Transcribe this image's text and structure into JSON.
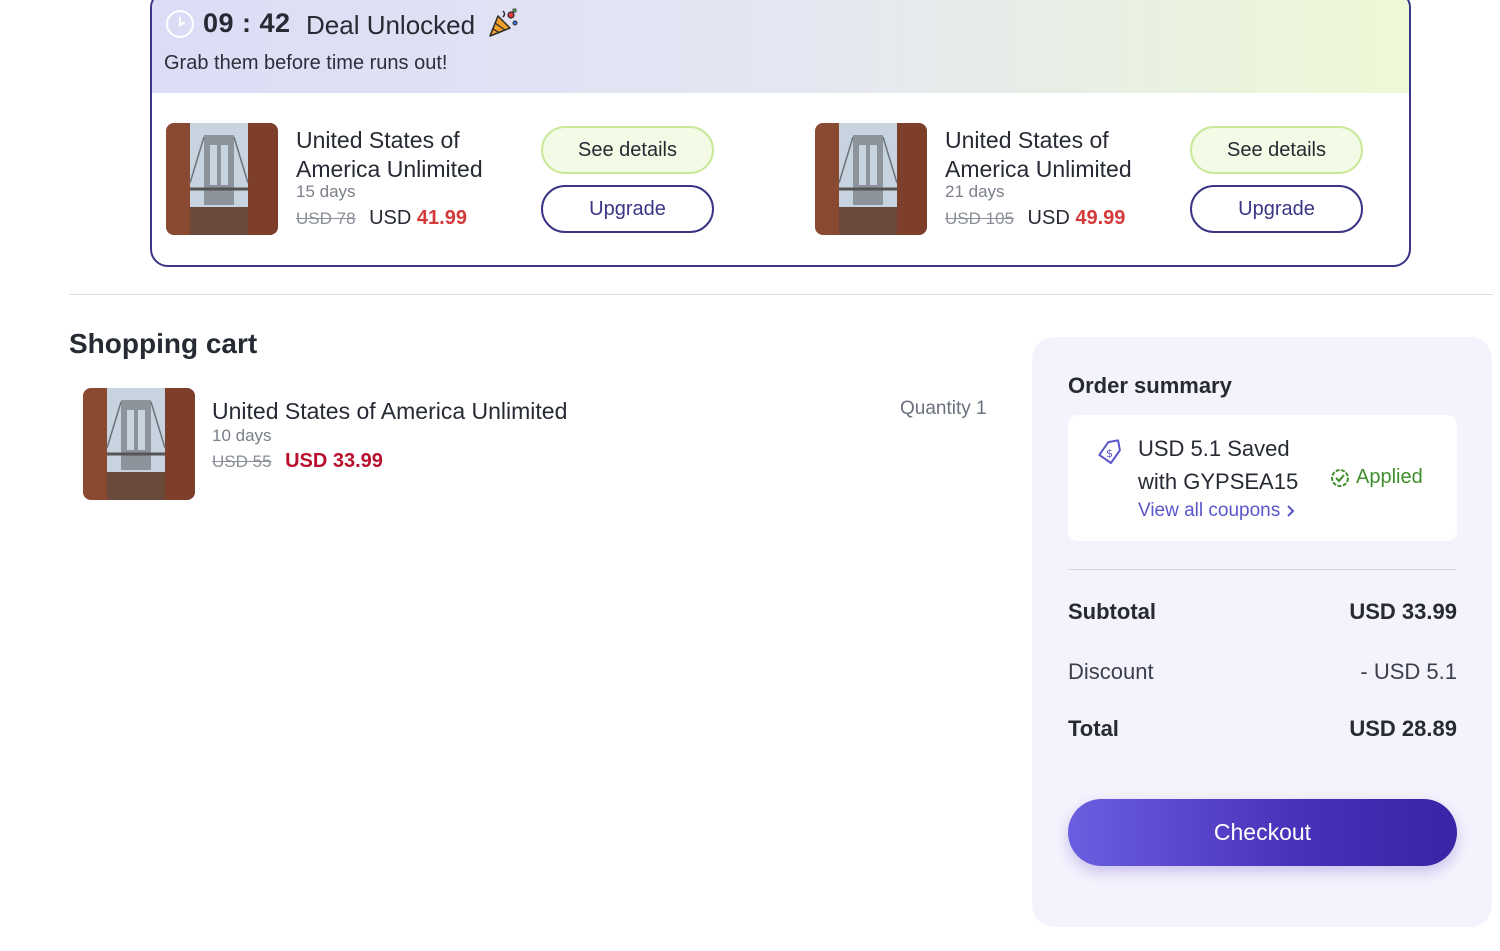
{
  "deal": {
    "timer": "09 : 42",
    "title": "Deal Unlocked",
    "subtitle": "Grab them before time runs out!",
    "offers": [
      {
        "name": "United States of America Unlimited",
        "days": "15 days",
        "old_price": "USD 78",
        "currency": "USD",
        "price": "41.99",
        "details_label": "See details",
        "upgrade_label": "Upgrade"
      },
      {
        "name": "United States of America Unlimited",
        "days": "21 days",
        "old_price": "USD 105",
        "currency": "USD",
        "price": "49.99",
        "details_label": "See details",
        "upgrade_label": "Upgrade"
      }
    ]
  },
  "cart": {
    "title": "Shopping cart",
    "item": {
      "name": "United States of America Unlimited",
      "days": "10 days",
      "old_price": "USD 55",
      "price": "USD 33.99",
      "quantity": "Quantity 1"
    }
  },
  "summary": {
    "title": "Order summary",
    "coupon_text": "USD 5.1 Saved with GYPSEA15",
    "applied": "Applied",
    "view_coupons": "View all coupons",
    "subtotal_label": "Subtotal",
    "subtotal_value": "USD 33.99",
    "discount_label": "Discount",
    "discount_value": "- USD 5.1",
    "total_label": "Total",
    "total_value": "USD 28.89",
    "checkout_label": "Checkout"
  },
  "colors": {
    "brand": "#3a3585",
    "accent_green": "#c9e89a",
    "price_red": "#d43a3a",
    "applied_green": "#3f8f2c"
  }
}
